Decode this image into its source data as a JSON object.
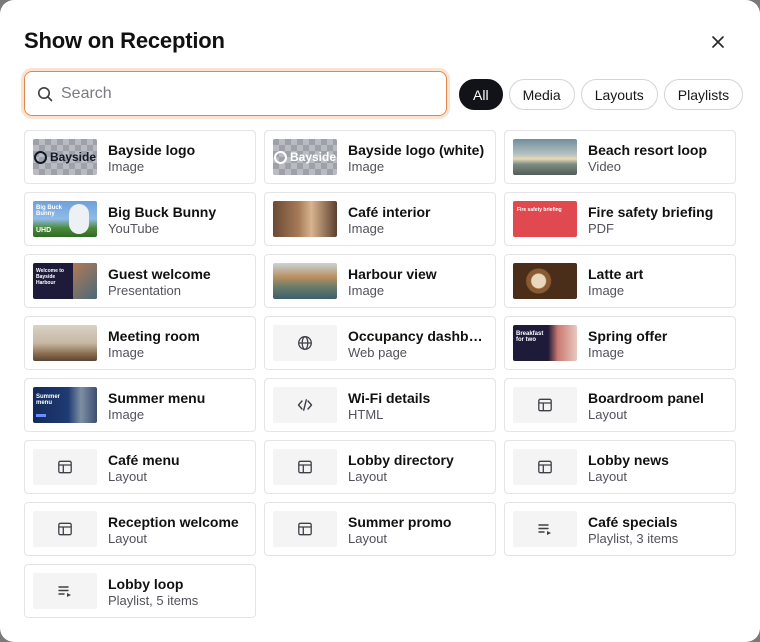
{
  "dialog": {
    "title": "Show on Reception",
    "search": {
      "placeholder": "Search",
      "value": ""
    },
    "filters": [
      {
        "label": "All",
        "active": true
      },
      {
        "label": "Media",
        "active": false
      },
      {
        "label": "Layouts",
        "active": false
      },
      {
        "label": "Playlists",
        "active": false
      }
    ]
  },
  "items": [
    {
      "name": "Bayside logo",
      "type": "Image",
      "thumb": "bayside-logo"
    },
    {
      "name": "Bayside logo (white)",
      "type": "Image",
      "thumb": "bayside-logo-white"
    },
    {
      "name": "Beach resort loop",
      "type": "Video",
      "thumb": "beach"
    },
    {
      "name": "Big Buck Bunny",
      "type": "YouTube",
      "thumb": "bunny"
    },
    {
      "name": "Café interior",
      "type": "Image",
      "thumb": "cafe"
    },
    {
      "name": "Fire safety briefing",
      "type": "PDF",
      "thumb": "fire"
    },
    {
      "name": "Guest welcome",
      "type": "Presentation",
      "thumb": "guest"
    },
    {
      "name": "Harbour view",
      "type": "Image",
      "thumb": "harbour"
    },
    {
      "name": "Latte art",
      "type": "Image",
      "thumb": "latte"
    },
    {
      "name": "Meeting room",
      "type": "Image",
      "thumb": "meeting"
    },
    {
      "name": "Occupancy dashboard",
      "type": "Web page",
      "thumb": "globe-icon"
    },
    {
      "name": "Spring offer",
      "type": "Image",
      "thumb": "spring"
    },
    {
      "name": "Summer menu",
      "type": "Image",
      "thumb": "summer"
    },
    {
      "name": "Wi-Fi details",
      "type": "HTML",
      "thumb": "code-icon"
    },
    {
      "name": "Boardroom panel",
      "type": "Layout",
      "thumb": "layout-icon"
    },
    {
      "name": "Café menu",
      "type": "Layout",
      "thumb": "layout-icon"
    },
    {
      "name": "Lobby directory",
      "type": "Layout",
      "thumb": "layout-icon"
    },
    {
      "name": "Lobby news",
      "type": "Layout",
      "thumb": "layout-icon"
    },
    {
      "name": "Reception welcome",
      "type": "Layout",
      "thumb": "layout-icon"
    },
    {
      "name": "Summer promo",
      "type": "Layout",
      "thumb": "layout-icon"
    },
    {
      "name": "Café specials",
      "type": "Playlist, 3 items",
      "thumb": "playlist-icon"
    },
    {
      "name": "Lobby loop",
      "type": "Playlist, 5 items",
      "thumb": "playlist-icon"
    }
  ],
  "thumb_text": {
    "bayside": "Bayside",
    "bunny": "Big Buck Bunny",
    "bunny_badge": "UHD",
    "guest": "Welcome to Bayside Harbour",
    "fire": "Fire safety briefing",
    "spring": "Breakfast for two",
    "summer": "Summer menu"
  },
  "colors": {
    "accent": "#e2874b",
    "active_chip": "#111318"
  }
}
